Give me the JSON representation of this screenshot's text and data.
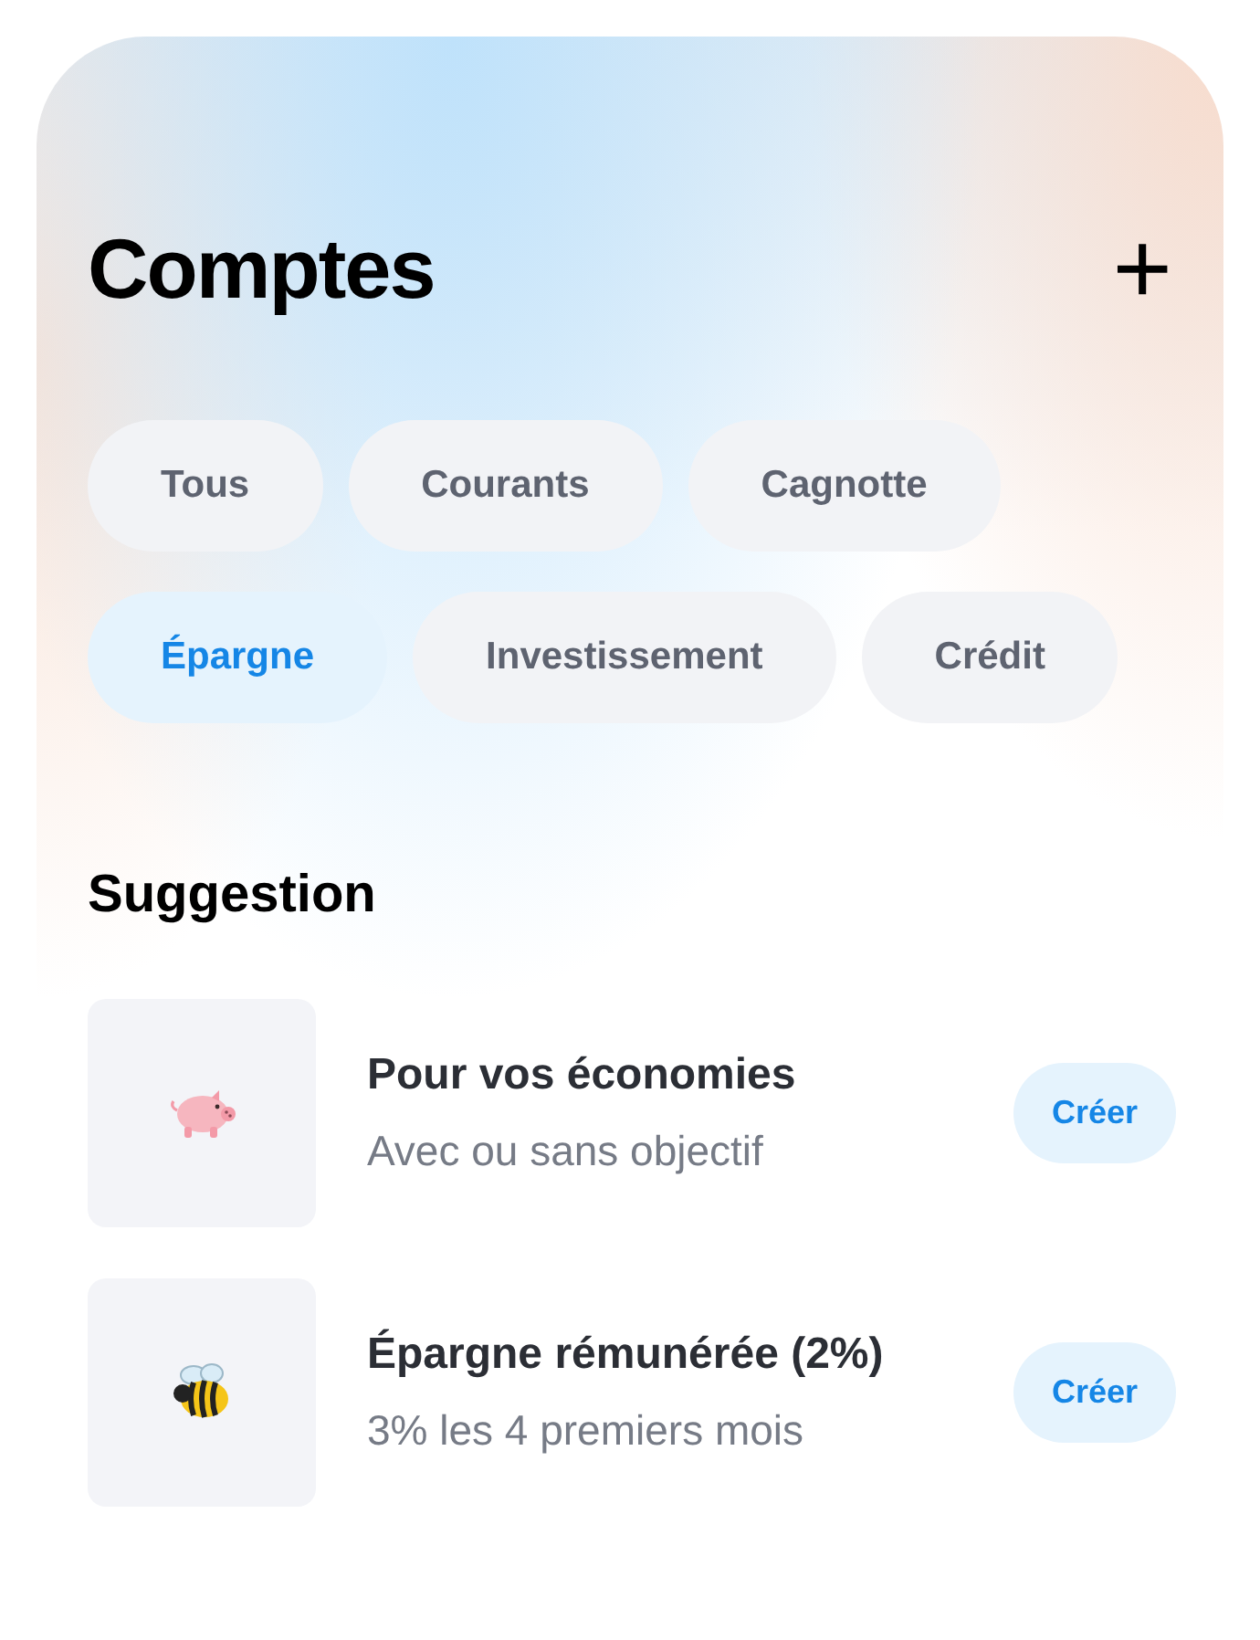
{
  "header": {
    "title": "Comptes",
    "add_button": "+"
  },
  "filters": [
    {
      "label": "Tous",
      "selected": false
    },
    {
      "label": "Courants",
      "selected": false
    },
    {
      "label": "Cagnotte",
      "selected": false
    },
    {
      "label": "Épargne",
      "selected": true
    },
    {
      "label": "Investissement",
      "selected": false
    },
    {
      "label": "Crédit",
      "selected": false
    }
  ],
  "suggestion": {
    "heading": "Suggestion",
    "items": [
      {
        "title": "Pour vos économies",
        "subtitle": "Avec ou sans objectif",
        "button": "Créer"
      },
      {
        "title": "Épargne rémunérée (2%)",
        "subtitle": "3% les 4 premiers mois",
        "button": "Créer"
      }
    ]
  }
}
